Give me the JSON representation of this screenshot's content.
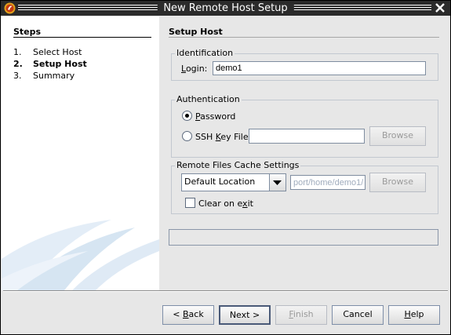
{
  "window": {
    "title": "New Remote Host Setup"
  },
  "steps": {
    "heading": "Steps",
    "items": [
      {
        "num": "1.",
        "label": "Select Host"
      },
      {
        "num": "2.",
        "label": "Setup Host"
      },
      {
        "num": "3.",
        "label": "Summary"
      }
    ]
  },
  "main": {
    "title": "Setup Host",
    "identification": {
      "label": "Identification",
      "login_label": "Login:",
      "login_value": "demo1"
    },
    "authentication": {
      "label": "Authentication",
      "password_label": "Password",
      "ssh_key_label": "SSH Key File",
      "ssh_key_value": "",
      "browse_label": "Browse",
      "selected": "password"
    },
    "cache": {
      "label": "Remote Files Cache Settings",
      "location_value": "Default Location",
      "path_value": "port/home/demo1/.",
      "browse_label": "Browse",
      "clear_on_exit_label": "Clear on exit",
      "clear_on_exit": false
    },
    "status_text": ""
  },
  "buttons": {
    "back": "< Back",
    "next": "Next >",
    "finish": "Finish",
    "cancel": "Cancel",
    "help": "Help"
  },
  "colors": {
    "title_bar": "#2b2b2b",
    "dialog_bg": "#e7e7e7",
    "sidebar_bg": "#ffffff",
    "group_border": "#c2c8d0"
  }
}
